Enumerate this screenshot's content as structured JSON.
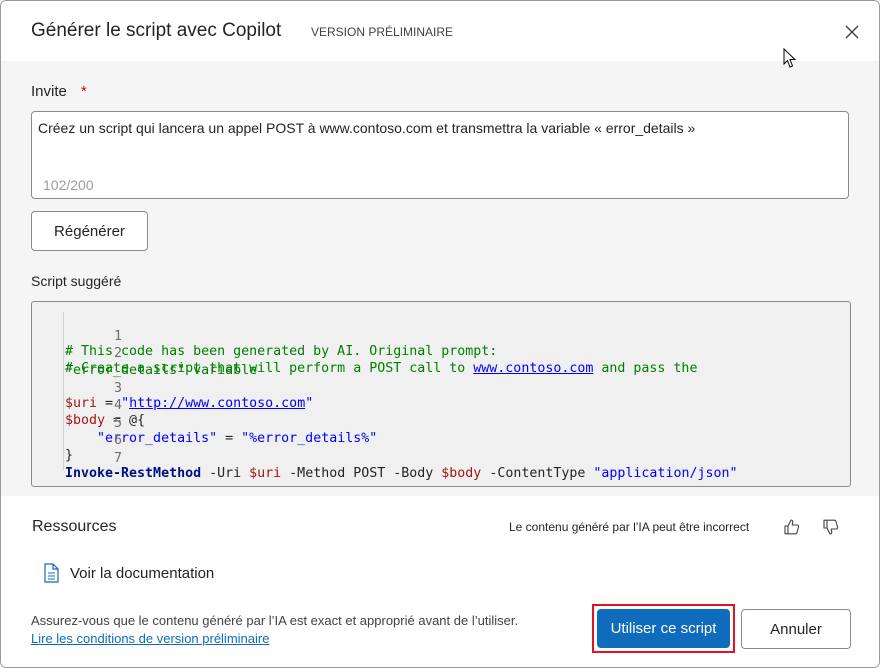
{
  "dialog": {
    "title": "Générer le script avec Copilot",
    "badge": "VERSION PRÉLIMINAIRE",
    "close_icon": "close-icon"
  },
  "prompt": {
    "label": "Invite",
    "required_mark": "*",
    "value": "Créez un script qui lancera un appel POST à www.contoso.com et transmettra la variable « error_details »",
    "char_count": "102/200"
  },
  "regenerate_label": "Régénérer",
  "suggested_script": {
    "label": "Script suggéré",
    "line_numbers": [
      "1",
      "2",
      "3",
      "4",
      "5",
      "6",
      "7"
    ],
    "line1": "# This code has been generated by AI. Original prompt:",
    "line2_prefix": "# Create a script that will perform a POST call to ",
    "line2_link": "www.contoso.com",
    "line2_suffix": " and pass the",
    "line2_wrap": "\"error_details\" variable",
    "line3_var": "$uri",
    "line3_eq": " = ",
    "line3_quote_open": "\"",
    "line3_link": "http://www.contoso.com",
    "line3_quote_close": "\"",
    "line4_var": "$body",
    "line4_rest": " = @{",
    "line5_key": "    \"error_details\"",
    "line5_eq": " = ",
    "line5_val": "\"%error_details%\"",
    "line6": "}",
    "line7_cmd": "Invoke-RestMethod",
    "line7_uri_flag": " -Uri ",
    "line7_uri_var": "$uri",
    "line7_method": " -Method POST -Body ",
    "line7_body_var": "$body",
    "line7_ct": " -ContentType ",
    "line7_ct_val": "\"application/json\""
  },
  "resources": {
    "title": "Ressources",
    "ai_note": "Le contenu généré par l’IA peut être incorrect",
    "thumbs_up_icon": "thumbs-up-icon",
    "thumbs_down_icon": "thumbs-down-icon",
    "doc_link": "Voir la documentation"
  },
  "footer": {
    "disclaimer": "Assurez-vous que le contenu généré par l’IA est exact et approprié avant de l’utiliser.",
    "terms_link": "Lire les conditions de version préliminaire",
    "primary_button": "Utiliser ce script",
    "cancel_button": "Annuler"
  },
  "colors": {
    "accent": "#0f6cbd",
    "highlight_frame": "#e81123",
    "required": "#c50f1f"
  }
}
